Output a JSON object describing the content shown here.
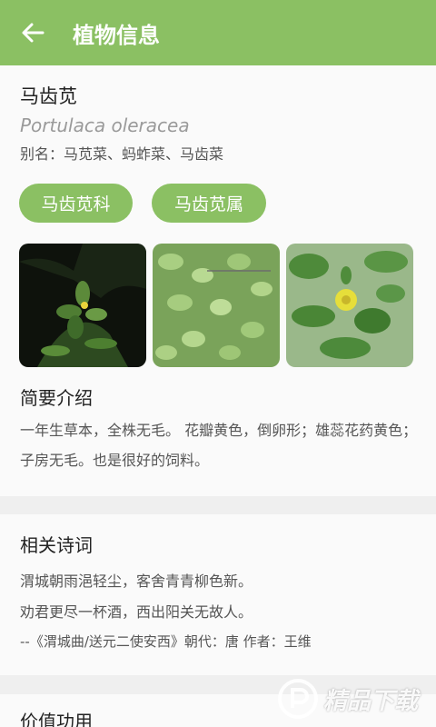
{
  "header": {
    "title": "植物信息",
    "back_icon": "arrow-left-icon"
  },
  "plant": {
    "name": "马齿苋",
    "latin": "Portulaca oleracea",
    "alias": "别名：马苋菜、蚂蚱菜、马齿菜",
    "family": "马齿苋科",
    "genus": "马齿苋属"
  },
  "intro": {
    "title": "简要介绍",
    "text": "一年生草本，全株无毛。 花瓣黄色，倒卵形；雄蕊花药黄色；子房无毛。也是很好的饲料。"
  },
  "poem": {
    "title": "相关诗词",
    "line1": "渭城朝雨浥轻尘，客舍青青柳色新。",
    "line2": "劝君更尽一杯酒，西出阳关无故人。",
    "source": "--《渭城曲/送元二使安西》朝代：唐 作者：王维"
  },
  "value": {
    "title": "价值功用"
  },
  "watermark": {
    "text": "精品下载"
  },
  "colors": {
    "accent": "#8bc063",
    "background": "#efefef",
    "card": "#fafafa"
  }
}
